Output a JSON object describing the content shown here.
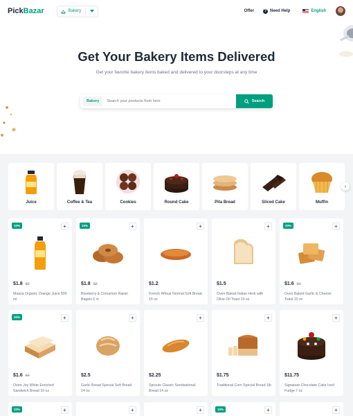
{
  "header": {
    "logo_main": "Pick",
    "logo_accent": "Bazar",
    "category": "Bakery",
    "offer": "Offer",
    "help": "Need Help",
    "language": "English"
  },
  "hero": {
    "title": "Get Your Bakery Items Delivered",
    "subtitle": "Get your favorite bakery items baked and delivered to your doorsteps at any time",
    "search_tag": "Bakery",
    "search_placeholder": "Search your products from here",
    "search_button": "Search"
  },
  "categories": [
    {
      "label": "Juice",
      "icon": "juice-bottle-icon"
    },
    {
      "label": "Coffee & Tea",
      "icon": "coffee-icon"
    },
    {
      "label": "Cookies",
      "icon": "cookies-icon"
    },
    {
      "label": "Round Cake",
      "icon": "round-cake-icon"
    },
    {
      "label": "Pita Bread",
      "icon": "pita-bread-icon"
    },
    {
      "label": "Sliced Cake",
      "icon": "sliced-cake-icon"
    },
    {
      "label": "Muffin",
      "icon": "muffin-icon"
    }
  ],
  "products": [
    {
      "badge": "10%",
      "price": "$1.8",
      "old_price": "$2",
      "name": "Maaza Organic Orange Juice 500 ml",
      "img": "juice"
    },
    {
      "badge": "10%",
      "price": "$1.8",
      "old_price": "$2",
      "name": "Blueberry & Cinnamon Raisin Bagels 6 ct",
      "img": "bagels"
    },
    {
      "badge": "",
      "price": "$1.2",
      "old_price": "",
      "name": "French Wheat Normal Soft Bread 15 oz",
      "img": "roll"
    },
    {
      "badge": "",
      "price": "$1.5",
      "old_price": "",
      "name": "Oven Baked Italian Herb with Olive Oil Toast 10 oz",
      "img": "toast"
    },
    {
      "badge": "20%",
      "price": "$1.6",
      "old_price": "$2",
      "name": "Oven Baked Garlic & Cheese Toast 10 oz",
      "img": "toasts"
    },
    {
      "badge": "20%",
      "price": "$1.6",
      "old_price": "$2",
      "name": "Oven-Joy White Enriched Sandwich Bread 16 oz",
      "img": "sandwich"
    },
    {
      "badge": "",
      "price": "$2.5",
      "old_price": "",
      "name": "Garlic Bread Special Soft Bread 14 oz",
      "img": "round"
    },
    {
      "badge": "",
      "price": "$2.25",
      "old_price": "",
      "name": "Sprouts Classic Seedsational Bread 14 oz",
      "img": "long"
    },
    {
      "badge": "",
      "price": "$1.75",
      "old_price": "",
      "name": "Traditional Corn Special Bread 1lb",
      "img": "loaf"
    },
    {
      "badge": "",
      "price": "$11.75",
      "old_price": "",
      "name": "Signature Chocolate Cake Iced Fudge 7 oz",
      "img": "cake"
    },
    {
      "badge": "20%",
      "price": "",
      "old_price": "",
      "name": "",
      "img": ""
    },
    {
      "badge": "",
      "price": "",
      "old_price": "",
      "name": "",
      "img": ""
    },
    {
      "badge": "",
      "price": "",
      "old_price": "",
      "name": "",
      "img": ""
    },
    {
      "badge": "10%",
      "price": "",
      "old_price": "",
      "name": "",
      "img": ""
    },
    {
      "badge": "",
      "price": "",
      "old_price": "",
      "name": "",
      "img": ""
    }
  ]
}
